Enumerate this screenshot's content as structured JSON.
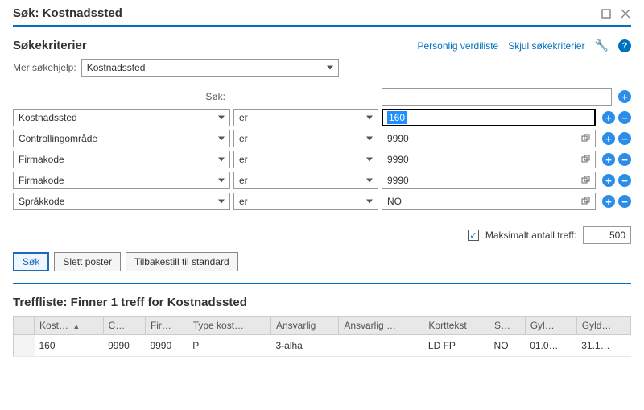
{
  "window": {
    "title": "Søk: Kostnadssted"
  },
  "criteria_section": {
    "title": "Søkekriterier",
    "link_personal": "Personlig verdiliste",
    "link_hide": "Skjul søkekriterier"
  },
  "more_help": {
    "label": "Mer søkehjelp:",
    "value": "Kostnadssted"
  },
  "search_row": {
    "label": "Søk:",
    "value": ""
  },
  "criteria": [
    {
      "field": "Kostnadssted",
      "op": "er",
      "value": "160",
      "focused": true,
      "valuehelp": false
    },
    {
      "field": "Controllingområde",
      "op": "er",
      "value": "9990",
      "focused": false,
      "valuehelp": true
    },
    {
      "field": "Firmakode",
      "op": "er",
      "value": "9990",
      "focused": false,
      "valuehelp": true
    },
    {
      "field": "Firmakode",
      "op": "er",
      "value": "9990",
      "focused": false,
      "valuehelp": true
    },
    {
      "field": "Språkkode",
      "op": "er",
      "value": "NO",
      "focused": false,
      "valuehelp": true
    }
  ],
  "max_hits": {
    "label": "Maksimalt antall treff:",
    "value": "500",
    "checked": true
  },
  "buttons": {
    "search": "Søk",
    "clear": "Slett poster",
    "reset": "Tilbakestill til standard"
  },
  "results": {
    "title": "Treffliste: Finner 1 treff for Kostnadssted",
    "columns": [
      "Kost…",
      "C…",
      "Fir…",
      "Type kost…",
      "Ansvarlig",
      "Ansvarlig …",
      "Korttekst",
      "S…",
      "Gyl…",
      "Gyld…"
    ],
    "rows": [
      {
        "cells": [
          "160",
          "9990",
          "9990",
          "P",
          "3-alha",
          "",
          "LD FP",
          "NO",
          "01.0…",
          "31.1…"
        ]
      }
    ]
  }
}
